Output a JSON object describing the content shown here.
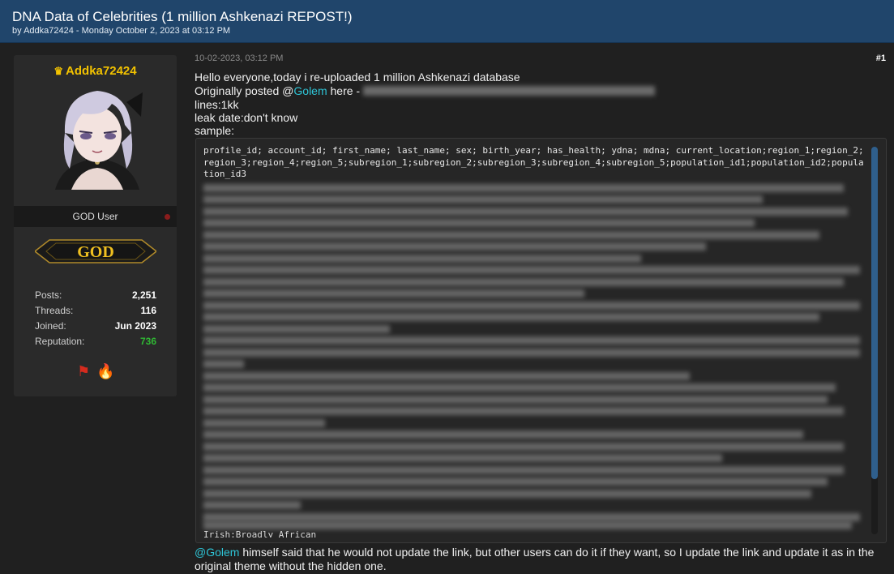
{
  "thread": {
    "title": "DNA Data of Celebrities (1 million Ashkenazi REPOST!)",
    "byline": "by Addka72424 - Monday October 2, 2023 at 03:12 PM"
  },
  "user": {
    "name": "Addka72424",
    "role": "GOD User",
    "rank_badge": "GOD",
    "stats": [
      {
        "label": "Posts:",
        "value": "2,251"
      },
      {
        "label": "Threads:",
        "value": "116"
      },
      {
        "label": "Joined:",
        "value": "Jun 2023"
      },
      {
        "label": "Reputation:",
        "value": "736"
      }
    ],
    "award_icons": [
      "flag-icon",
      "fire-icon"
    ]
  },
  "post": {
    "date": "10-02-2023, 03:12 PM",
    "number": "#1",
    "line1": "Hello everyone,today i re-uploaded 1 million Ashkenazi database",
    "line2_prefix": "Originally posted @",
    "line2_mention": "Golem",
    "line2_suffix": "  here -",
    "line3": "lines:1kk",
    "line4": "leak date:don't know",
    "line5": "sample:",
    "code_header": "profile_id; account_id; first_name; last_name; sex; birth_year; has_health; ydna; mdna; current_location;region_1;region_2;region_3;region_4;region_5;subregion_1;subregion_2;subregion_3;subregion_4;subregion_5;population_id1;population_id2;population_id3",
    "code_tail": "Irish;Broadly African",
    "footer_prefix": "@",
    "footer_mention": "Golem",
    "footer_text": " himself said that he would not update the link, but other users can do it if they want, so I update the link and update it as in the original theme without the hidden one."
  },
  "colors": {
    "header_bg": "#20456b",
    "username": "#f2c200",
    "mention": "#2ec4d6",
    "reputation": "#2fb833",
    "scrollbar": "#2f5f8c"
  }
}
